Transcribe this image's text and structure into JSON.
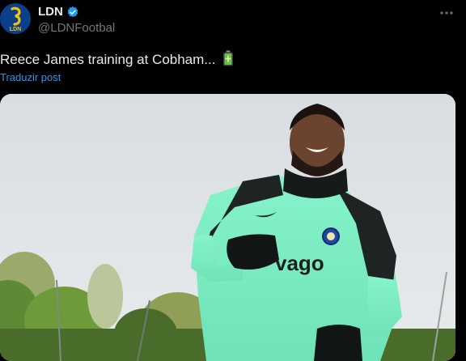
{
  "account": {
    "display_name": "LDN",
    "handle": "@LDNFootbal",
    "avatar_text": "LDN",
    "verified": true
  },
  "post": {
    "text": "Reece James training at Cobham... ",
    "emoji": "battery-icon",
    "translate_label": "Traduzir post"
  },
  "media": {
    "shirt_sponsor": "vago"
  },
  "colors": {
    "link": "#1d9bf0",
    "verified": "#1d9bf0",
    "jersey": "#7ef0c4"
  }
}
